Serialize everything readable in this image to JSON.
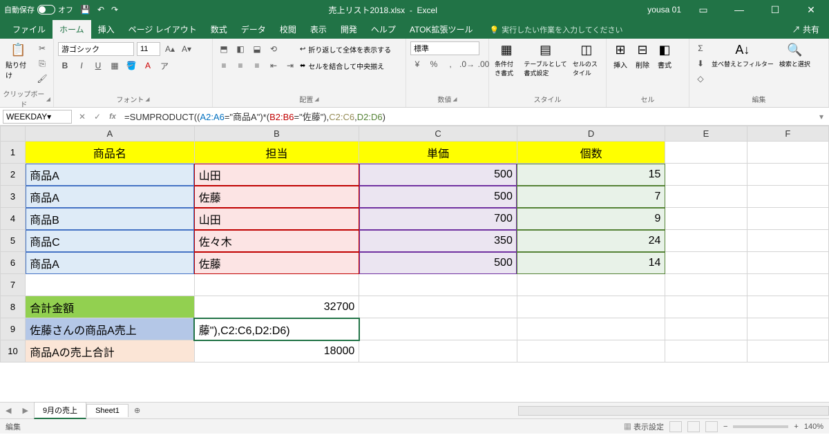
{
  "titlebar": {
    "autosave_label": "自動保存",
    "autosave_state": "オフ",
    "filename": "売上リスト2018.xlsx",
    "app": "Excel",
    "username": "yousa 01"
  },
  "tabs": {
    "file": "ファイル",
    "home": "ホーム",
    "insert": "挿入",
    "pagelayout": "ページ レイアウト",
    "formulas": "数式",
    "data": "データ",
    "review": "校閲",
    "view": "表示",
    "developer": "開発",
    "help": "ヘルプ",
    "atok": "ATOK拡張ツール",
    "tellme_placeholder": "実行したい作業を入力してください",
    "share": "共有"
  },
  "ribbon": {
    "clipboard": {
      "label": "クリップボード",
      "paste": "貼り付け"
    },
    "font": {
      "label": "フォント",
      "name": "游ゴシック",
      "size": "11"
    },
    "alignment": {
      "label": "配置",
      "wrap": "折り返して全体を表示する",
      "merge": "セルを結合して中央揃え"
    },
    "number": {
      "label": "数値",
      "format": "標準"
    },
    "styles": {
      "label": "スタイル",
      "conditional": "条件付き書式",
      "table": "テーブルとして書式設定",
      "cell": "セルのスタイル"
    },
    "cells": {
      "label": "セル",
      "insert": "挿入",
      "delete": "削除",
      "format": "書式"
    },
    "editing": {
      "label": "編集",
      "sort": "並べ替えとフィルター",
      "find": "検索と選択"
    }
  },
  "formula_bar": {
    "namebox": "WEEKDAY",
    "formula_prefix": "=SUMPRODUCT((",
    "ref1": "A2:A6",
    "mid1": "=\"商品A\")*(",
    "ref2": "B2:B6",
    "mid2": "=\"佐藤\"),",
    "ref3": "C2:C6",
    "mid3": ",",
    "ref4": "D2:D6",
    "suffix": ")"
  },
  "chart_data": {
    "type": "table",
    "headers": {
      "A": "商品名",
      "B": "担当",
      "C": "単価",
      "D": "個数"
    },
    "rows": [
      {
        "A": "商品A",
        "B": "山田",
        "C": 500,
        "D": 15
      },
      {
        "A": "商品A",
        "B": "佐藤",
        "C": 500,
        "D": 7
      },
      {
        "A": "商品B",
        "B": "山田",
        "C": 700,
        "D": 9
      },
      {
        "A": "商品C",
        "B": "佐々木",
        "C": 350,
        "D": 24
      },
      {
        "A": "商品A",
        "B": "佐藤",
        "C": 500,
        "D": 14
      }
    ],
    "summary": {
      "total_label": "合計金額",
      "total_value": 32700,
      "sato_label": "佐藤さんの商品A売上",
      "sato_display": "藤\"),C2:C6,D2:D6)",
      "productA_label": "商品Aの売上合計",
      "productA_value": 18000
    }
  },
  "sheets": {
    "s1": "9月の売上",
    "s2": "Sheet1"
  },
  "statusbar": {
    "mode": "編集",
    "display_settings": "表示設定",
    "zoom": "140%"
  }
}
